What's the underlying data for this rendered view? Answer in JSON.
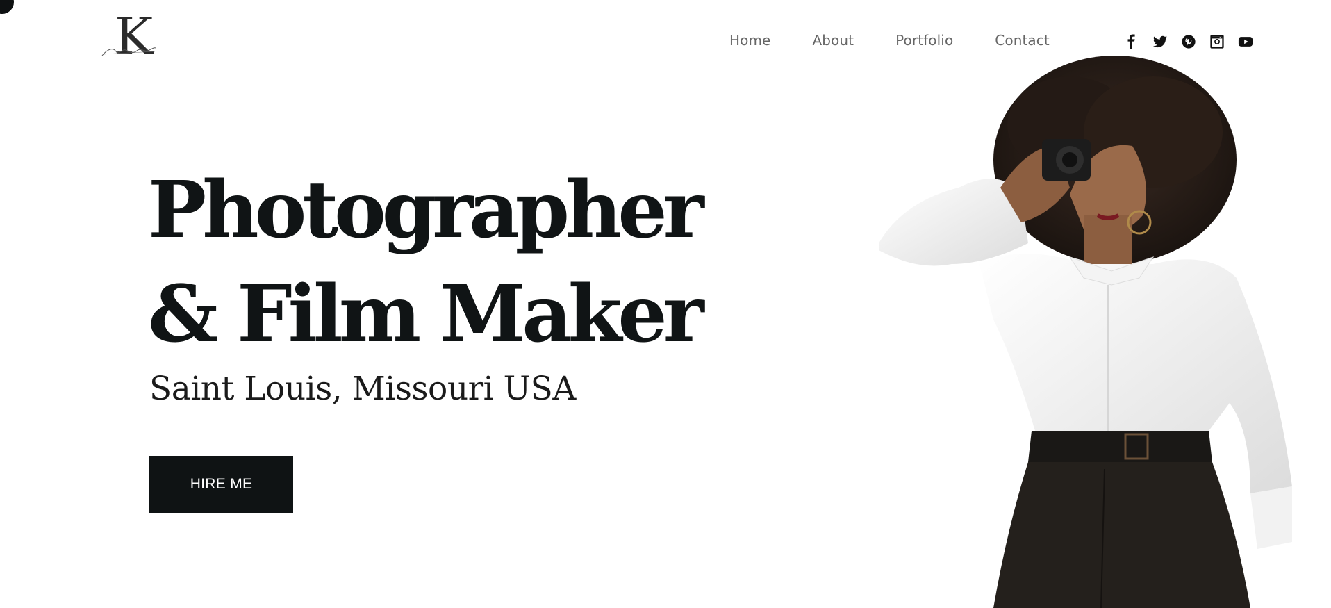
{
  "brand": {
    "logo_letter": "K",
    "logo_script": "Sultane",
    "accent": "#0f1314"
  },
  "nav": {
    "items": [
      "Home",
      "About",
      "Portfolio",
      "Contact"
    ]
  },
  "social": {
    "icons": [
      "facebook-icon",
      "twitter-icon",
      "pinterest-icon",
      "instagram-icon",
      "youtube-icon"
    ]
  },
  "hero": {
    "title_line1": "Photographer",
    "title_line2": "& Film Maker",
    "location": "Saint Louis, Missouri USA",
    "cta_label": "HIRE ME"
  }
}
